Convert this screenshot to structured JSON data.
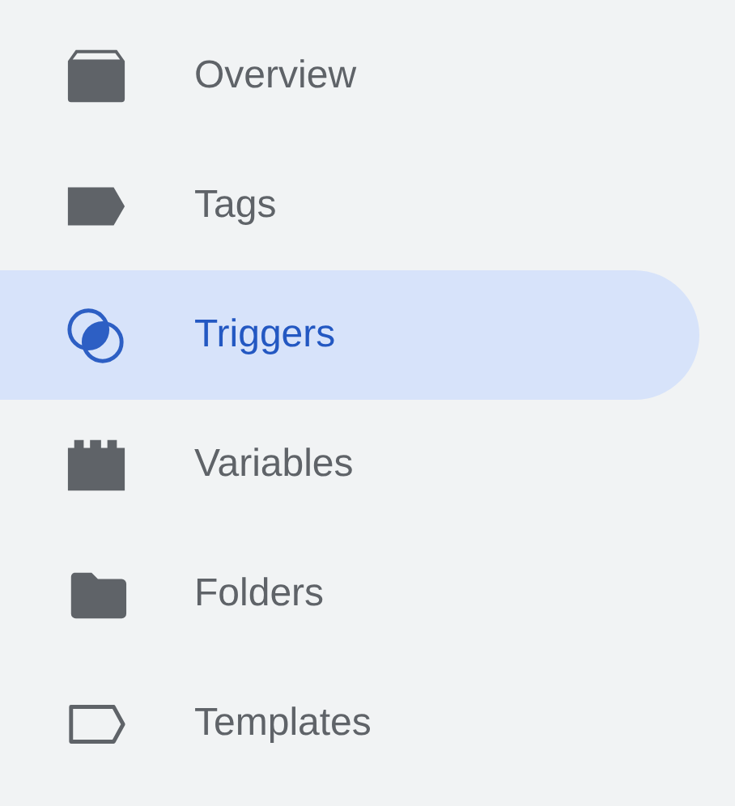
{
  "nav_items": [
    {
      "label": "Overview",
      "selected": false
    },
    {
      "label": "Tags",
      "selected": false
    },
    {
      "label": "Triggers",
      "selected": true
    },
    {
      "label": "Variables",
      "selected": false
    },
    {
      "label": "Folders",
      "selected": false
    },
    {
      "label": "Templates",
      "selected": false
    }
  ]
}
